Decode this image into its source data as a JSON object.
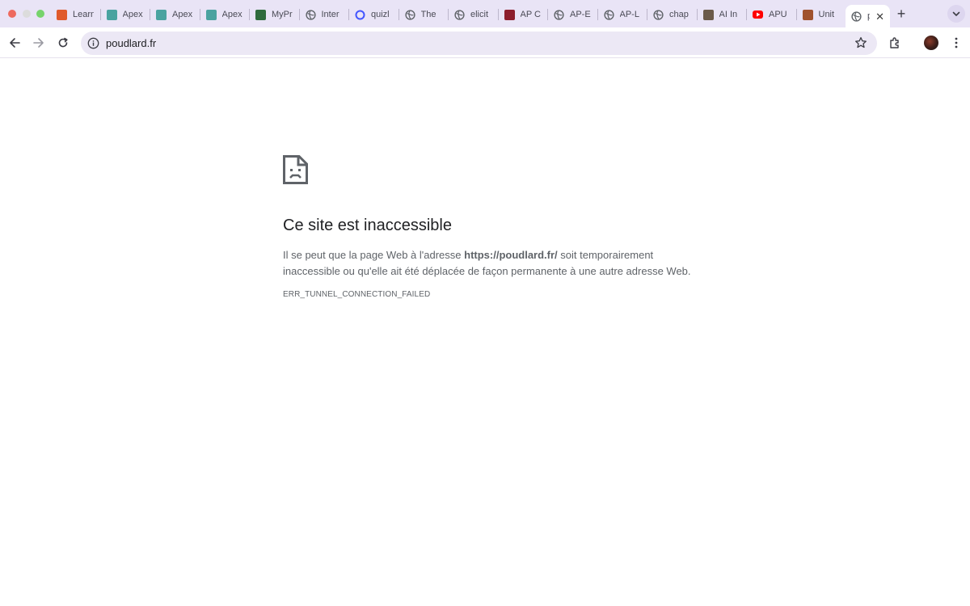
{
  "browser": {
    "tabs": [
      {
        "title": "Learn",
        "icon": "learn-favicon",
        "color": "#e05a2b"
      },
      {
        "title": "Apex",
        "icon": "apex-favicon",
        "color": "#4aa3a0"
      },
      {
        "title": "Apex",
        "icon": "apex-favicon",
        "color": "#4aa3a0"
      },
      {
        "title": "Apex",
        "icon": "apex-favicon",
        "color": "#4aa3a0"
      },
      {
        "title": "MyPr",
        "icon": "mypr-favicon",
        "color": "#2f6b3d"
      },
      {
        "title": "Inter",
        "icon": "globe-favicon",
        "color": "#5f6368"
      },
      {
        "title": "quizl",
        "icon": "quizlet-favicon",
        "color": "#4255ff"
      },
      {
        "title": "The",
        "icon": "globe-favicon",
        "color": "#5f6368"
      },
      {
        "title": "elicit",
        "icon": "globe-favicon",
        "color": "#5f6368"
      },
      {
        "title": "AP C",
        "icon": "ap-favicon",
        "color": "#8c1d2c"
      },
      {
        "title": "AP-E",
        "icon": "globe-favicon",
        "color": "#5f6368"
      },
      {
        "title": "AP-L",
        "icon": "globe-favicon",
        "color": "#5f6368"
      },
      {
        "title": "chap",
        "icon": "globe-favicon",
        "color": "#5f6368"
      },
      {
        "title": "AI In",
        "icon": "ai-favicon",
        "color": "#6b5a4a"
      },
      {
        "title": "APU",
        "icon": "youtube-favicon",
        "color": "#ff0000"
      },
      {
        "title": "Unit",
        "icon": "feather-favicon",
        "color": "#a0522d"
      }
    ],
    "active_tab": {
      "title": "p",
      "icon": "globe-favicon",
      "close_label": "✕"
    },
    "new_tab_label": "+",
    "url": "poudlard.fr"
  },
  "error": {
    "title": "Ce site est inaccessible",
    "desc_before": "Il se peut que la page Web à l'adresse ",
    "desc_url": "https://poudlard.fr/",
    "desc_after": " soit temporairement inaccessible ou qu'elle ait été déplacée de façon permanente à une autre adresse Web.",
    "code": "ERR_TUNNEL_CONNECTION_FAILED"
  }
}
